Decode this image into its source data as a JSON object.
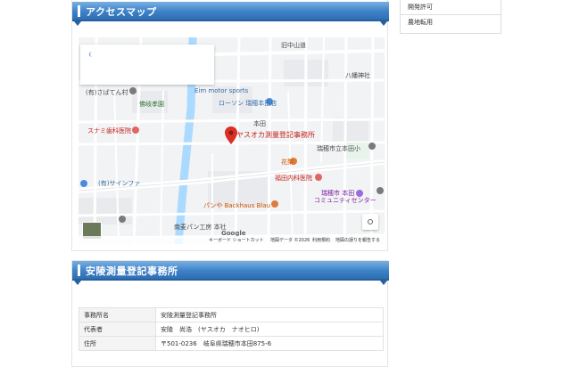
{
  "sidebar": {
    "items": [
      {
        "label": "開発許可"
      },
      {
        "label": "農地転用"
      }
    ]
  },
  "access": {
    "heading": "アクセスマップ"
  },
  "map": {
    "pin_label": "ヤスオカ測量登記事務所",
    "labels": [
      "(有)さばてん村",
      "Eim motor sports",
      "ローソン 瑞穂本田店",
      "本田",
      "八幡神社",
      "瑞穂市立本田小",
      "花梨",
      "福田内科医院",
      "瑞穂市 本田",
      "コミュニティセンター",
      "スナミ歯科医院",
      "パンや Backhaus Blau",
      "(有)サインファ",
      "南麦パン工房 本社",
      "旧中山道",
      "佛岐孝園",
      "Google"
    ],
    "attribution": {
      "shortcuts": "キーボード ショートカット",
      "map_data": "地図データ ©2026",
      "terms": "利用規約",
      "report": "地図の誤りを報告する"
    }
  },
  "office": {
    "heading": "安陵測量登記事務所",
    "rows": [
      {
        "key": "事務所名",
        "value": "安陵測量登記事務所"
      },
      {
        "key": "代表者",
        "value": "安陵　尚浩　(ヤスオカ　ナオヒロ)"
      },
      {
        "key": "住所",
        "value": "〒501-0236　岐阜県瑞穂市本田875-6"
      }
    ]
  },
  "colors": {
    "banner": "#3d82c8",
    "pin": "#d93025",
    "river": "#aadaff",
    "road": "#ffffff"
  }
}
